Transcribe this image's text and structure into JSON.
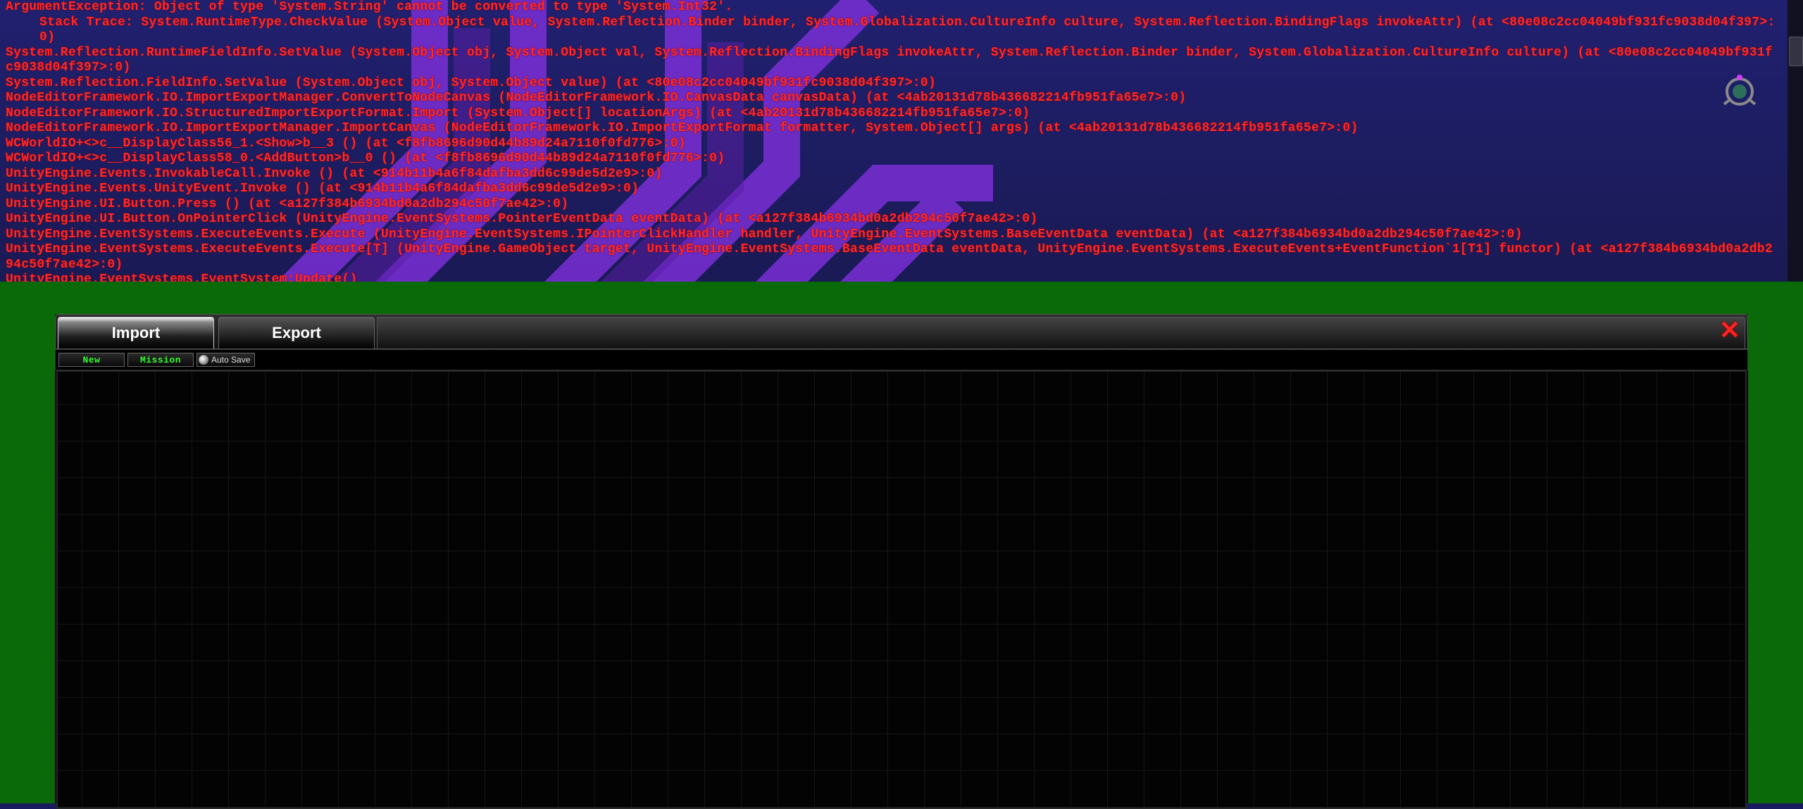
{
  "console": {
    "lines": [
      {
        "text": "ArgumentException: Object of type 'System.String' cannot be converted to type 'System.Int32'.",
        "indent": false
      },
      {
        "text": "Stack Trace: System.RuntimeType.CheckValue (System.Object value, System.Reflection.Binder binder, System.Globalization.CultureInfo culture, System.Reflection.BindingFlags invokeAttr) (at <80e08c2cc04049bf931fc9038d04f397>:0)",
        "indent": true
      },
      {
        "text": "System.Reflection.RuntimeFieldInfo.SetValue (System.Object obj, System.Object val, System.Reflection.BindingFlags invokeAttr, System.Reflection.Binder binder, System.Globalization.CultureInfo culture) (at <80e08c2cc04049bf931fc9038d04f397>:0)",
        "indent": false
      },
      {
        "text": "System.Reflection.FieldInfo.SetValue (System.Object obj, System.Object value) (at <80e08c2cc04049bf931fc9038d04f397>:0)",
        "indent": false
      },
      {
        "text": "NodeEditorFramework.IO.ImportExportManager.ConvertToNodeCanvas (NodeEditorFramework.IO.CanvasData canvasData) (at <4ab20131d78b436682214fb951fa65e7>:0)",
        "indent": false
      },
      {
        "text": "NodeEditorFramework.IO.StructuredImportExportFormat.Import (System.Object[] locationArgs) (at <4ab20131d78b436682214fb951fa65e7>:0)",
        "indent": false
      },
      {
        "text": "NodeEditorFramework.IO.ImportExportManager.ImportCanvas (NodeEditorFramework.IO.ImportExportFormat formatter, System.Object[] args) (at <4ab20131d78b436682214fb951fa65e7>:0)",
        "indent": false
      },
      {
        "text": "WCWorldIO+<>c__DisplayClass56_1.<Show>b__3 () (at <f8fb8696d90d44b89d24a7110f0fd776>:0)",
        "indent": false
      },
      {
        "text": "WCWorldIO+<>c__DisplayClass58_0.<AddButton>b__0 () (at <f8fb8696d90d44b89d24a7110f0fd776>:0)",
        "indent": false
      },
      {
        "text": "UnityEngine.Events.InvokableCall.Invoke () (at <914b11b4a6f84dafba3dd6c99de5d2e9>:0)",
        "indent": false
      },
      {
        "text": "UnityEngine.Events.UnityEvent.Invoke () (at <914b11b4a6f84dafba3dd6c99de5d2e9>:0)",
        "indent": false
      },
      {
        "text": "UnityEngine.UI.Button.Press () (at <a127f384b6934bd0a2db294c50f7ae42>:0)",
        "indent": false
      },
      {
        "text": "UnityEngine.UI.Button.OnPointerClick (UnityEngine.EventSystems.PointerEventData eventData) (at <a127f384b6934bd0a2db294c50f7ae42>:0)",
        "indent": false
      },
      {
        "text": "UnityEngine.EventSystems.ExecuteEvents.Execute (UnityEngine.EventSystems.IPointerClickHandler handler, UnityEngine.EventSystems.BaseEventData eventData) (at <a127f384b6934bd0a2db294c50f7ae42>:0)",
        "indent": false
      },
      {
        "text": "UnityEngine.EventSystems.ExecuteEvents.Execute[T] (UnityEngine.GameObject target, UnityEngine.EventSystems.BaseEventData eventData, UnityEngine.EventSystems.ExecuteEvents+EventFunction`1[T1] functor) (at <a127f384b6934bd0a2db294c50f7ae42>:0)",
        "indent": false
      },
      {
        "text": "UnityEngine.EventSystems.EventSystem:Update()",
        "indent": false
      }
    ]
  },
  "editor": {
    "tabs": {
      "import": "Import",
      "export": "Export"
    },
    "close": "✕",
    "subbar": {
      "new_btn": "New",
      "mission_btn": "Mission",
      "autosave_label": "Auto Save"
    }
  }
}
